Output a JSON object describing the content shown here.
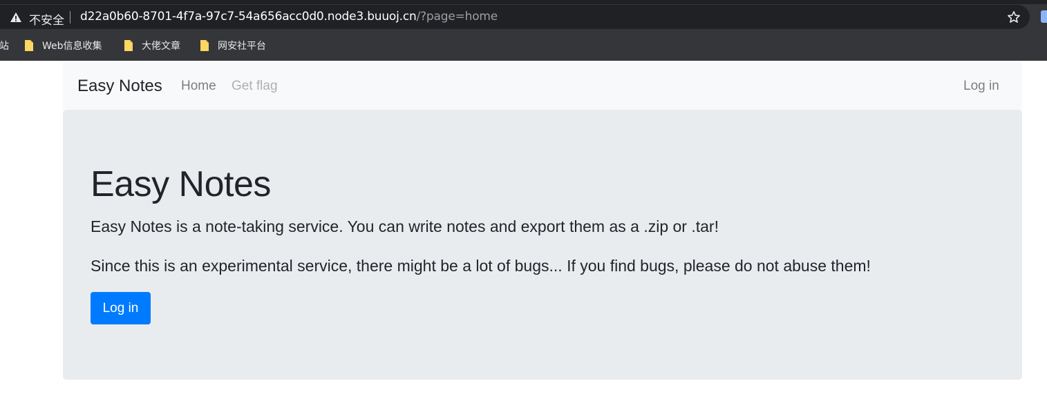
{
  "browser": {
    "security_label": "不安全",
    "url_host": "d22a0b60-8701-4f7a-97c7-54a656acc0d0.node3.buuoj.cn",
    "url_path": "/?page=home",
    "bookmarks": [
      {
        "label": "站"
      },
      {
        "label": "Web信息收集"
      },
      {
        "label": "大佬文章"
      },
      {
        "label": "网安社平台"
      }
    ],
    "icons": {
      "security": "warning-triangle-icon",
      "bookmark_star": "star-icon",
      "folder": "folder-icon"
    }
  },
  "navbar": {
    "brand": "Easy Notes",
    "links": [
      {
        "label": "Home",
        "disabled": false
      },
      {
        "label": "Get flag",
        "disabled": true
      }
    ],
    "login": "Log in"
  },
  "jumbotron": {
    "title": "Easy Notes",
    "lead1": "Easy Notes is a note-taking service. You can write notes and export them as a .zip or .tar!",
    "lead2": "Since this is an experimental service, there might be a lot of bugs... If you find bugs, please do not abuse them!",
    "button": "Log in"
  },
  "colors": {
    "primary": "#007bff",
    "navbar_bg": "#f8f9fa",
    "jumbotron_bg": "#e9ecef",
    "folder": "#fdd663"
  }
}
